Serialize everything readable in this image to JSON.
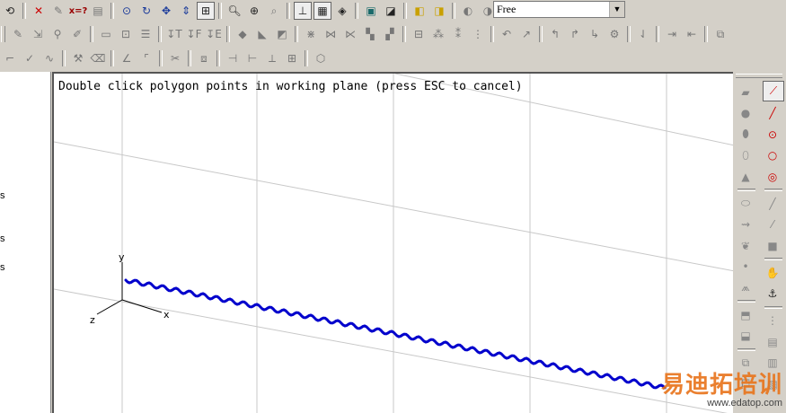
{
  "toolbar": {
    "row1_icons": [
      "undo-icon",
      "delete-icon",
      "erase-icon",
      "query-value-icon",
      "layer-icon",
      "view-rotate-icon",
      "refresh-icon",
      "pan-icon",
      "look-icon",
      "zoom-window-icon",
      "zoom-icon",
      "zoom-all-icon",
      "fit-icon",
      "triad-icon",
      "grid-icon",
      "workplane-icon",
      "save-icon",
      "model-icon",
      "assign-icon",
      "hide-icon",
      "show-icon"
    ],
    "view_mode_value": "Free",
    "row2_icons": [
      "pen-icon",
      "pointer-icon",
      "tag-icon",
      "pen2-icon",
      "monitor-icon",
      "graph-icon",
      "list-icon",
      "t-icon",
      "f-icon",
      "e-icon",
      "shape-icon",
      "shape2-icon",
      "shape3-icon",
      "mesh-icon",
      "mesh2-icon",
      "mesh3-icon",
      "mesh4-icon",
      "mesh5-icon",
      "doc-icon",
      "people-icon",
      "people2-icon",
      "node-icon",
      "arrow-icon",
      "arrow2-icon",
      "arrow3-icon",
      "arrow4-icon",
      "arrow5-icon",
      "gear-icon",
      "sort-icon",
      "beam-icon",
      "beam2-icon",
      "group-icon"
    ],
    "row3_icons": [
      "link-icon",
      "check-icon",
      "wave-icon",
      "settings-icon",
      "eraser-icon",
      "angle-icon",
      "angle2-icon",
      "cut-icon",
      "box-icon",
      "split-icon",
      "split2-icon",
      "split3-icon",
      "grid2-icon",
      "cube-icon"
    ]
  },
  "left_panel": {
    "labels": [
      "s",
      "s",
      "s"
    ]
  },
  "viewport": {
    "prompt": "Double click polygon points in working plane (press ESC to cancel)",
    "axis_labels": {
      "y": "y",
      "x": "x",
      "z": "z"
    },
    "curve_color": "#0000cc"
  },
  "right_toolbar": {
    "col1_icons": [
      "surface-icon",
      "sphere-icon",
      "shape-a-icon",
      "shape-b-icon",
      "cone-icon",
      "ellipse-icon",
      "loft-icon",
      "sweep-icon",
      "point-icon",
      "revolve-icon",
      "extrude-icon",
      "shell-icon",
      "bool-icon",
      "copy-icon",
      "mirror-icon",
      "scale-icon"
    ],
    "col2_icons": [
      "polyline-icon",
      "line-icon",
      "circle-center-icon",
      "circle-icon",
      "arc-icon",
      "straight-line-icon",
      "fraction-line-icon",
      "rectangle-icon",
      "hand-icon",
      "anchor-icon",
      "doc-a-icon",
      "doc-b-icon",
      "doc-c-icon",
      "doc-d-icon",
      "doc-e-icon",
      "target-icon"
    ]
  },
  "watermark": {
    "text": "易迪拓培训",
    "url": "www.edatop.com"
  }
}
